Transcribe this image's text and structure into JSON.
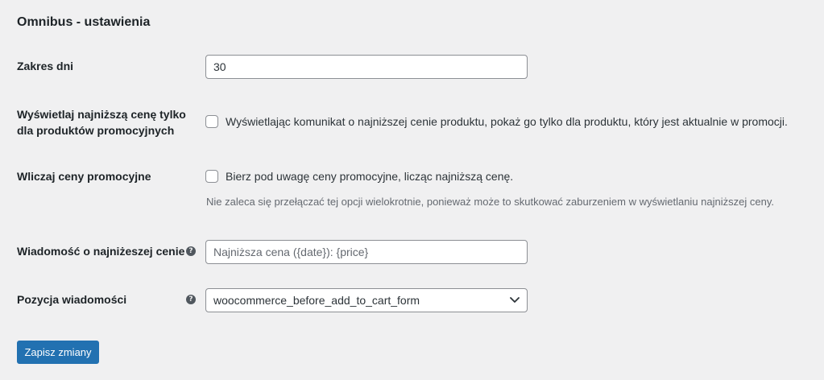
{
  "page": {
    "title": "Omnibus - ustawienia"
  },
  "settings": {
    "days_range": {
      "label": "Zakres dni",
      "value": "30"
    },
    "show_only_promo": {
      "label_line1": "Wyświetlaj najniższą cenę tylko",
      "label_line2": "dla produktów promocyjnych",
      "checked": false,
      "checkbox_label": "Wyświetlając komunikat o najniższej cenie produktu, pokaż go tylko dla produktu, który jest aktualnie w promocji."
    },
    "include_promo_prices": {
      "label": "Wliczaj ceny promocyjne",
      "checked": false,
      "checkbox_label": "Bierz pod uwagę ceny promocyjne, licząc najniższą cenę.",
      "description": "Nie zaleca się przełączać tej opcji wielokrotnie, ponieważ może to skutkować zaburzeniem w wyświetlaniu najniższej ceny."
    },
    "lowest_price_message": {
      "label": "Wiadomość o najniżeszej cenie",
      "value": "",
      "placeholder": "Najniższa cena ({date}): {price}",
      "help_icon": "?"
    },
    "message_position": {
      "label": "Pozycja wiadomości",
      "selected": "woocommerce_before_add_to_cart_form",
      "help_icon": "?"
    }
  },
  "actions": {
    "save_label": "Zapisz zmiany",
    "save_color": "#2271b1"
  }
}
